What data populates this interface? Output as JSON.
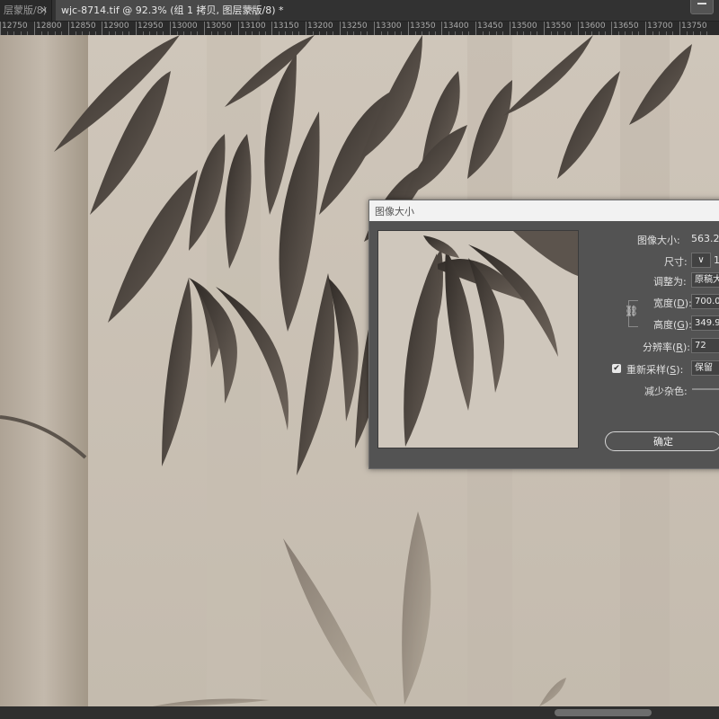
{
  "tabs": [
    {
      "label": "层蒙版/8)",
      "active": false,
      "close": "×"
    },
    {
      "label": "wjc-8714.tif @ 92.3% (组 1 拷贝, 图层蒙版/8) *",
      "active": true,
      "close": "×"
    }
  ],
  "ruler": {
    "ticks": [
      "12750",
      "12800",
      "12850",
      "12900",
      "12950",
      "13000",
      "13050",
      "13100",
      "13150",
      "13200",
      "13250",
      "13300",
      "13350",
      "13400",
      "13450",
      "13500",
      "13550",
      "13600",
      "13650",
      "13700",
      "13750"
    ]
  },
  "dialog": {
    "title": "图像大小",
    "image_size_label": "图像大小:",
    "image_size_value": "563.2",
    "dimensions_label": "尺寸:",
    "dimensions_value": "1",
    "fit_to_label": "调整为:",
    "fit_to_value": "原稿大",
    "width_label": "宽度",
    "width_key": "D",
    "width_value": "700.0",
    "height_label": "高度",
    "height_key": "G",
    "height_value": "349.9",
    "resolution_label": "分辨率",
    "resolution_key": "R",
    "resolution_value": "72",
    "resample_label": "重新采样",
    "resample_key": "S",
    "resample_checked": true,
    "resample_value": "保留",
    "reduce_noise_label": "减少杂色:",
    "ok_label": "确定"
  },
  "colors": {
    "ui_dark": "#323232",
    "dialog_bg": "#535353",
    "canvas_bg": "#c9c0b4",
    "ink": "#3e3732"
  }
}
